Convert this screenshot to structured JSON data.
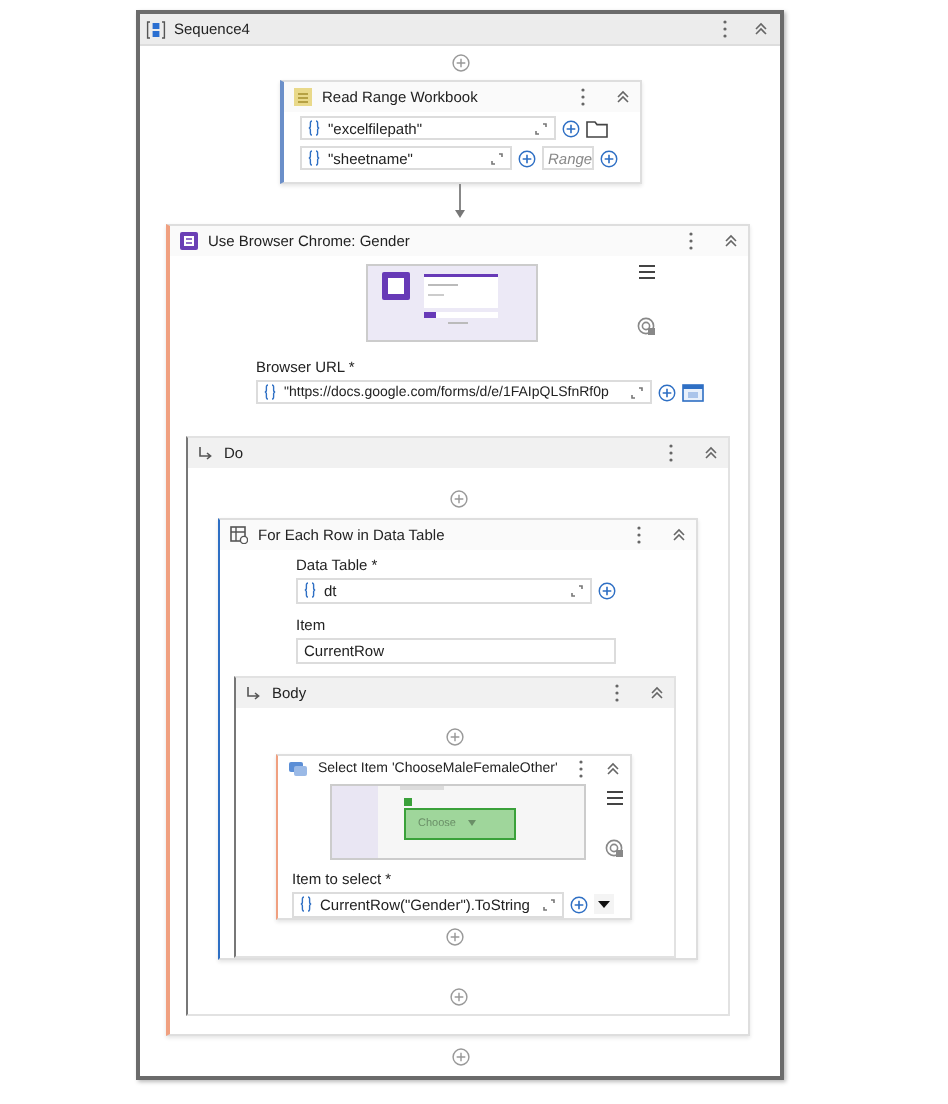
{
  "sequence": {
    "title": "Sequence4"
  },
  "read_range": {
    "title": "Read Range Workbook",
    "fields": [
      {
        "kind": "path",
        "value": "\"excelfilepath\""
      },
      {
        "kind": "sheet",
        "value": "\"sheetname\"",
        "placeholder": "Range"
      }
    ]
  },
  "use_browser": {
    "title": "Use Browser Chrome: Gender",
    "url_label": "Browser URL *",
    "url": "\"https://docs.google.com/forms/d/e/1FAIpQLSfnRf0p",
    "do": {
      "title": "Do",
      "for_each": {
        "title": "For Each Row in Data Table",
        "data_table_label": "Data Table *",
        "data_table": "dt",
        "item_label": "Item",
        "item": "CurrentRow",
        "body": {
          "title": "Body",
          "select_item": {
            "title": "Select Item 'ChooseMaleFemaleOther'",
            "dropdown": "Choose",
            "item_label": "Item to select *",
            "item_value": "CurrentRow(\"Gender\").ToString"
          }
        }
      }
    }
  }
}
